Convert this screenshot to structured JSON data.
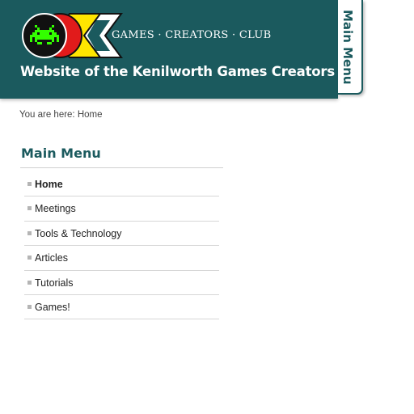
{
  "header": {
    "tagline": "GAMES · CREATORS · CLUB",
    "site_title": "Website of the Kenilworth Games Creators Club",
    "logo_icon": "gcc-logo-space-invader-icon",
    "colors": {
      "header_bg": "#1b5a5e",
      "invader": "#33ff00",
      "logo_red": "#e11b1b",
      "logo_yellow": "#ffe600"
    }
  },
  "menu_tab": {
    "label": "Main Menu"
  },
  "breadcrumb": {
    "text": "You are here: Home"
  },
  "main_menu": {
    "title": "Main Menu",
    "items": [
      {
        "label": "Home",
        "active": true
      },
      {
        "label": "Meetings",
        "active": false
      },
      {
        "label": "Tools & Technology",
        "active": false
      },
      {
        "label": "Articles",
        "active": false
      },
      {
        "label": "Tutorials",
        "active": false
      },
      {
        "label": "Games!",
        "active": false
      }
    ]
  }
}
